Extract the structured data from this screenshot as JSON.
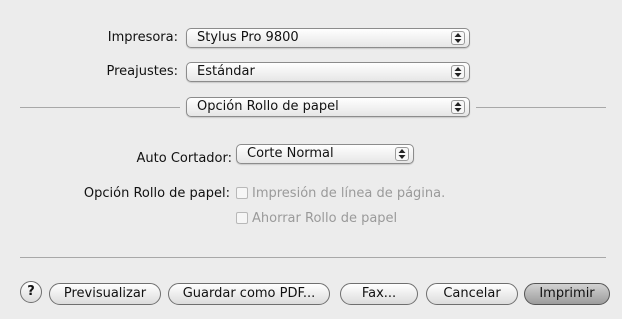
{
  "printer": {
    "label": "Impresora:",
    "value": "Stylus Pro 9800"
  },
  "presets": {
    "label": "Preajustes:",
    "value": "Estándar"
  },
  "pane_selector": {
    "value": "Opción Rollo de papel"
  },
  "auto_cutter": {
    "label": "Auto Cortador:",
    "value": "Corte Normal"
  },
  "roll_paper_option": {
    "label": "Opción Rollo de papel:",
    "checkboxes": [
      {
        "label": "Impresión de línea de página.",
        "checked": false,
        "enabled": false
      },
      {
        "label": "Ahorrar Rollo de papel",
        "checked": false,
        "enabled": false
      }
    ]
  },
  "buttons": {
    "help": "?",
    "preview": "Previsualizar",
    "save_pdf": "Guardar como PDF...",
    "fax": "Fax...",
    "cancel": "Cancelar",
    "print": "Imprimir"
  },
  "colors": {
    "background": "#ececec",
    "disabled_text": "#9a9a9a"
  }
}
